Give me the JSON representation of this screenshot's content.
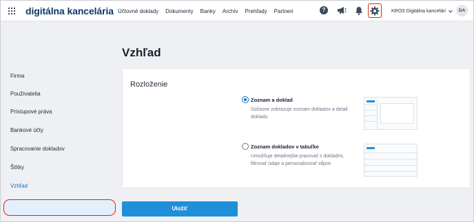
{
  "header": {
    "brand": "digitálna kancelária",
    "nav": [
      "Účtovné doklady",
      "Dokumenty",
      "Banky",
      "Archív",
      "Prehľady",
      "Partneri"
    ],
    "company": "KROS Digitálna kancelári",
    "avatar_initials": "DA",
    "help_glyph": "?"
  },
  "sidebar": {
    "items": [
      {
        "label": "Firma"
      },
      {
        "label": "Používatelia"
      },
      {
        "label": "Prístupové práva"
      },
      {
        "label": "Bankové účty"
      },
      {
        "label": "Spracovanie dokladov"
      },
      {
        "label": "Štítky"
      },
      {
        "label": "Vzhľad"
      }
    ],
    "active_index": 6
  },
  "main": {
    "title": "Vzhľad",
    "section_title": "Rozloženie",
    "options": [
      {
        "label": "Zoznam a doklad",
        "description": "Súčasne zobrazuje zoznam dokladov a detail dokladu",
        "selected": true
      },
      {
        "label": "Zoznam dokladov v tabuľke",
        "description": "Umožňuje detailnejšie pracovať s dokladmi, filtrovať údaje a personalizovať stĺpce",
        "selected": false
      }
    ],
    "save_label": "Uložiť"
  },
  "colors": {
    "accent": "#1e8fd8",
    "brand": "#0d3a66",
    "highlight": "#e0241b",
    "active_bg": "#e2f0fb"
  },
  "icons": [
    "apps-grid-icon",
    "help-icon",
    "megaphone-icon",
    "bell-icon",
    "gear-icon",
    "chevron-down-icon"
  ]
}
